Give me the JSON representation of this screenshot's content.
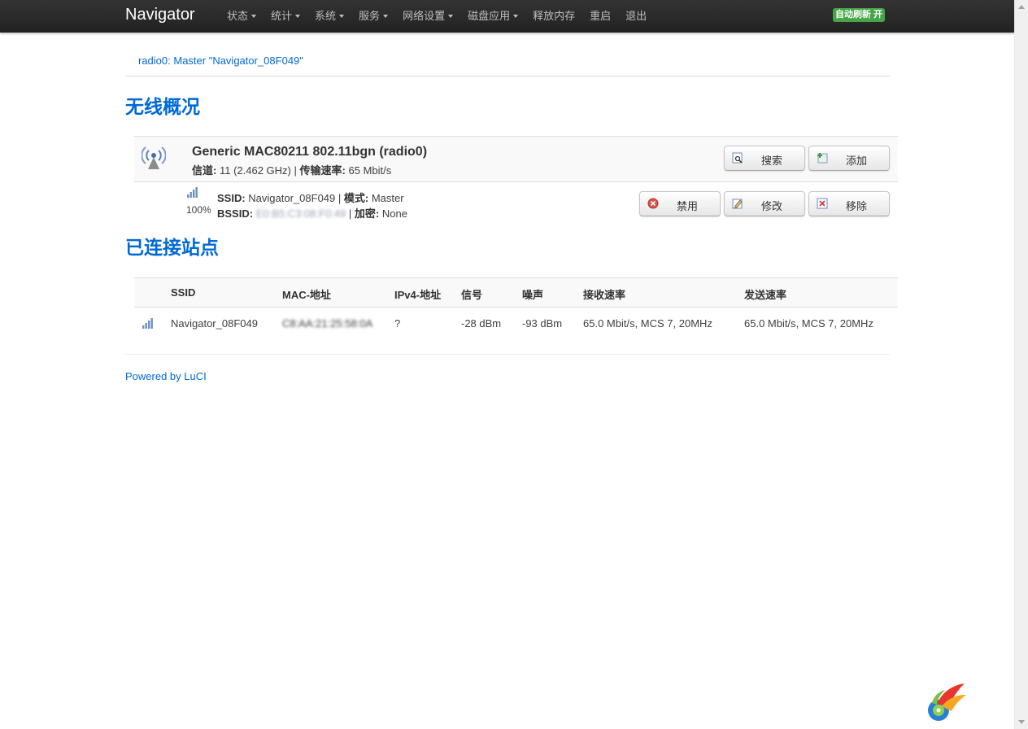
{
  "nav": {
    "brand": "Navigator",
    "menu": [
      {
        "label": "状态",
        "dropdown": true
      },
      {
        "label": "统计",
        "dropdown": true
      },
      {
        "label": "系统",
        "dropdown": true
      },
      {
        "label": "服务",
        "dropdown": true
      },
      {
        "label": "网络设置",
        "dropdown": true
      },
      {
        "label": "磁盘应用",
        "dropdown": true
      },
      {
        "label": "释放内存",
        "dropdown": false
      },
      {
        "label": "重启",
        "dropdown": false
      },
      {
        "label": "退出",
        "dropdown": false
      }
    ],
    "autorefresh": "自动刷新 开",
    "autorefresh_color": "#46a546"
  },
  "tab": {
    "label": "radio0: Master \"Navigator_08F049\""
  },
  "wifi": {
    "heading": "无线概况",
    "device": {
      "title": "Generic MAC80211 802.11bgn (radio0)",
      "channel_label": "信道:",
      "channel_value": "11 (2.462 GHz)",
      "rate_label": "传输速率:",
      "rate_value": "65 Mbit/s",
      "scan_button": "搜索",
      "add_button": "添加"
    },
    "network": {
      "signal_percent": "100%",
      "ssid_label": "SSID:",
      "ssid_value": "Navigator_08F049",
      "mode_label": "模式:",
      "mode_value": "Master",
      "bssid_label": "BSSID:",
      "bssid_value": "E0:B5:C3:08:F0:49",
      "enc_label": "加密:",
      "enc_value": "None",
      "disable_button": "禁用",
      "edit_button": "修改",
      "remove_button": "移除"
    }
  },
  "stations": {
    "heading": "已连接站点",
    "columns": [
      "SSID",
      "MAC-地址",
      "IPv4-地址",
      "信号",
      "噪声",
      "接收速率",
      "发送速率"
    ],
    "rows": [
      {
        "ssid": "Navigator_08F049",
        "mac": "C8:AA:21:25:58:0A",
        "ipv4": "?",
        "signal": "-28 dBm",
        "noise": "-93 dBm",
        "rx": "65.0 Mbit/s, MCS 7, 20MHz",
        "tx": "65.0 Mbit/s, MCS 7, 20MHz"
      }
    ]
  },
  "footer": {
    "powered": "Powered by LuCI"
  },
  "colors": {
    "link": "#0069d6",
    "navbar": "#222222"
  }
}
